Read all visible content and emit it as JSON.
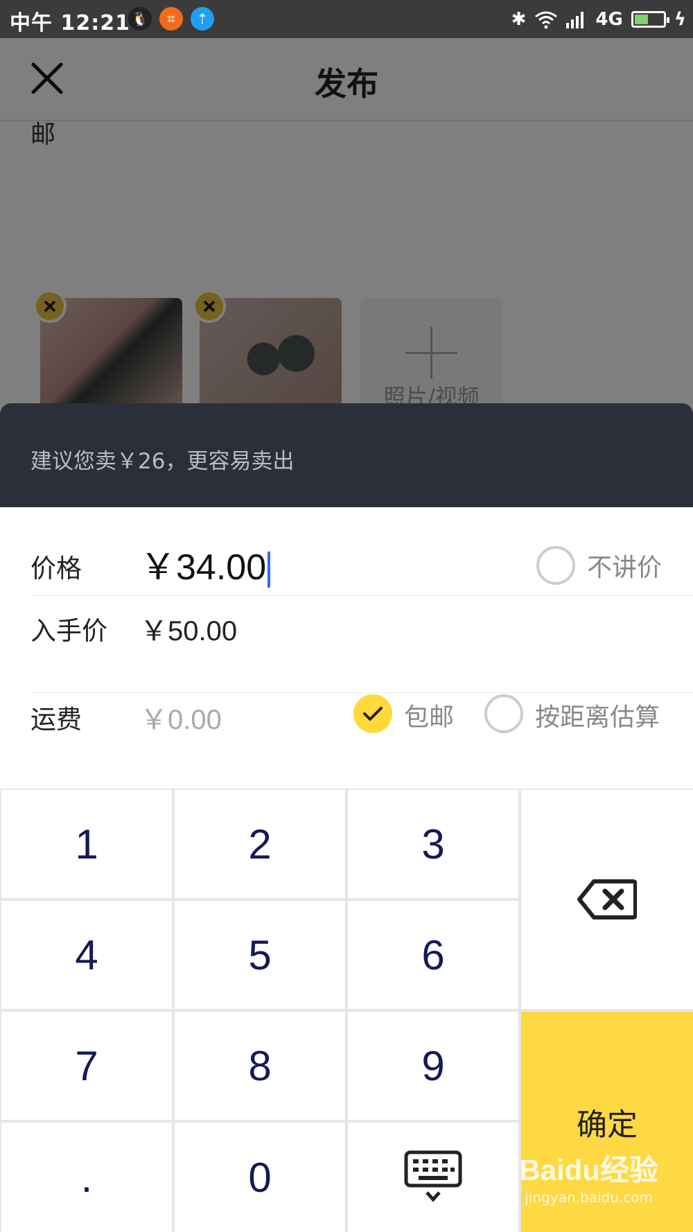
{
  "status_bar": {
    "time": "中午 12:21",
    "network": "4G",
    "battery_level": 0.45
  },
  "header": {
    "title": "发布"
  },
  "description_tail": "邮",
  "photos": {
    "add_label": "照片/视频"
  },
  "suggestion": {
    "text": "建议您卖￥26，更容易卖出"
  },
  "price": {
    "label": "价格",
    "value": "￥34.00",
    "no_bargain_label": "不讲价",
    "no_bargain_checked": false
  },
  "original_price": {
    "label": "入手价",
    "value": "￥50.00"
  },
  "shipping": {
    "label": "运费",
    "value": "￥0.00",
    "free_label": "包邮",
    "free_checked": true,
    "distance_label": "按距离估算",
    "distance_checked": false
  },
  "keypad": {
    "k1": "1",
    "k2": "2",
    "k3": "3",
    "k4": "4",
    "k5": "5",
    "k6": "6",
    "k7": "7",
    "k8": "8",
    "k9": "9",
    "kdot": ".",
    "k0": "0",
    "confirm": "确定"
  },
  "watermark": {
    "main": "Baidu经验",
    "sub": "jingyan.baidu.com"
  },
  "colors": {
    "accent": "#ffd944",
    "banner": "#2b2f3a",
    "cursor": "#2f6bff",
    "key_text": "#14195a"
  }
}
